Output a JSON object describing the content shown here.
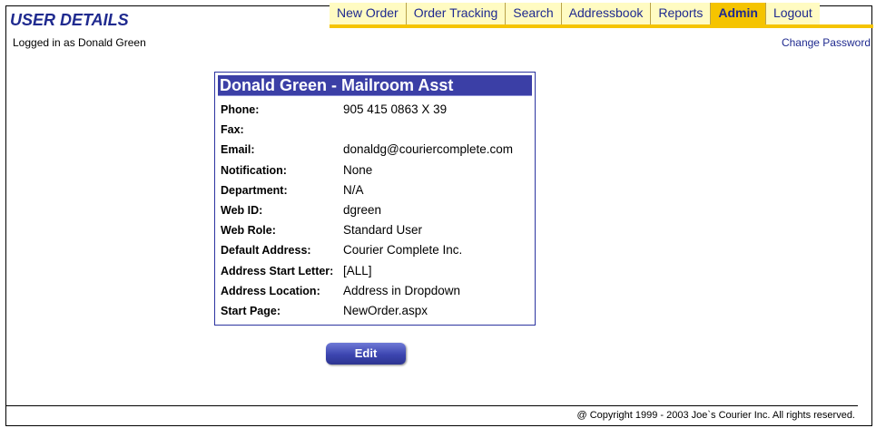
{
  "header": {
    "title": "USER DETAILS",
    "nav": [
      {
        "label": "New Order",
        "active": false
      },
      {
        "label": "Order Tracking",
        "active": false
      },
      {
        "label": "Search",
        "active": false
      },
      {
        "label": "Addressbook",
        "active": false
      },
      {
        "label": "Reports",
        "active": false
      },
      {
        "label": "Admin",
        "active": true
      },
      {
        "label": "Logout",
        "active": false
      }
    ]
  },
  "status": {
    "logged_in": "Logged in as Donald Green",
    "change_password": "Change Password"
  },
  "user_card": {
    "title": "Donald Green - Mailroom Asst",
    "fields": [
      {
        "label": "Phone:",
        "value": "905 415 0863 X 39"
      },
      {
        "label": "Fax:",
        "value": ""
      },
      {
        "label": "Email:",
        "value": "donaldg@couriercomplete.com"
      },
      {
        "label": "Notification:",
        "value": "None"
      },
      {
        "label": "Department:",
        "value": "N/A"
      },
      {
        "label": "Web ID:",
        "value": "dgreen"
      },
      {
        "label": "Web Role:",
        "value": "Standard User"
      },
      {
        "label": "Default Address:",
        "value": "Courier Complete Inc."
      },
      {
        "label": "Address Start Letter:",
        "value": "[ALL]"
      },
      {
        "label": "Address Location:",
        "value": "Address in Dropdown"
      },
      {
        "label": "Start Page:",
        "value": "NewOrder.aspx"
      }
    ]
  },
  "actions": {
    "edit_label": "Edit"
  },
  "footer": {
    "copyright": "@ Copyright 1999 - 2003   Joe`s Courier Inc. All rights reserved."
  },
  "colors": {
    "accent": "#f5c400",
    "nav_bg": "#fffbc2",
    "title_blue": "#1f2a8f",
    "card_header": "#3b3fa6"
  }
}
